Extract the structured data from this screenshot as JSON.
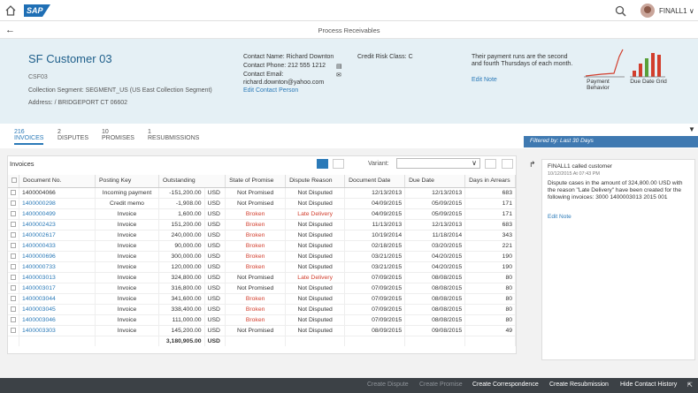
{
  "shell": {
    "logo": "SAP",
    "user": "FINALL1"
  },
  "title": "Process Receivables",
  "customer": {
    "name": "SF Customer 03",
    "id": "CSF03",
    "segment": "Collection Segment: SEGMENT_US (US East Collection Segment)",
    "address": "Address: / BRIDGEPORT CT 06602"
  },
  "contact": {
    "name": "Contact Name: Richard Downton",
    "phone": "Contact Phone: 212 555 1212",
    "email_label": "Contact Email:",
    "email": "richard.downton@yahoo.com",
    "edit": "Edit Contact Person"
  },
  "credit": "Credit Risk Class: C",
  "note": {
    "text": "Their payment runs are the second and fourth Thursdays of each month.",
    "edit": "Edit Note"
  },
  "mini": {
    "payment": "Payment Behavior",
    "duedate": "Due Date Grid"
  },
  "tabs": [
    {
      "count": "216",
      "label": "INVOICES"
    },
    {
      "count": "2",
      "label": "DISPUTES"
    },
    {
      "count": "10",
      "label": "PROMISES"
    },
    {
      "count": "1",
      "label": "RESUBMISSIONS"
    }
  ],
  "filter": "Filtered by: Last 30 Days",
  "invoices": {
    "title": "Invoices",
    "variant_label": "Variant:",
    "columns": [
      "Document No.",
      "Posting Key",
      "Outstanding",
      "State of Promise",
      "Dispute Reason",
      "Document Date",
      "Due Date",
      "Days in Arrears"
    ],
    "rows": [
      [
        "1400004066",
        "Incoming payment",
        "-151,200.00",
        "USD",
        "Not Promised",
        "Not Disputed",
        "12/13/2013",
        "12/13/2013",
        "683"
      ],
      [
        "1400000298",
        "Credit memo",
        "-1,908.00",
        "USD",
        "Not Promised",
        "Not Disputed",
        "04/09/2015",
        "05/09/2015",
        "171"
      ],
      [
        "1400000499",
        "Invoice",
        "1,600.00",
        "USD",
        "Broken",
        "Late Delivery",
        "04/09/2015",
        "05/09/2015",
        "171"
      ],
      [
        "1400002423",
        "Invoice",
        "151,200.00",
        "USD",
        "Broken",
        "Not Disputed",
        "11/13/2013",
        "12/13/2013",
        "683"
      ],
      [
        "1400002617",
        "Invoice",
        "240,000.00",
        "USD",
        "Broken",
        "Not Disputed",
        "10/19/2014",
        "11/18/2014",
        "343"
      ],
      [
        "1400000433",
        "Invoice",
        "90,000.00",
        "USD",
        "Broken",
        "Not Disputed",
        "02/18/2015",
        "03/20/2015",
        "221"
      ],
      [
        "1400000696",
        "Invoice",
        "300,000.00",
        "USD",
        "Broken",
        "Not Disputed",
        "03/21/2015",
        "04/20/2015",
        "190"
      ],
      [
        "1400000733",
        "Invoice",
        "120,000.00",
        "USD",
        "Broken",
        "Not Disputed",
        "03/21/2015",
        "04/20/2015",
        "190"
      ],
      [
        "1400003013",
        "Invoice",
        "324,800.00",
        "USD",
        "Not Promised",
        "Late Delivery",
        "07/09/2015",
        "08/08/2015",
        "80"
      ],
      [
        "1400003017",
        "Invoice",
        "316,800.00",
        "USD",
        "Not Promised",
        "Not Disputed",
        "07/09/2015",
        "08/08/2015",
        "80"
      ],
      [
        "1400003044",
        "Invoice",
        "341,600.00",
        "USD",
        "Broken",
        "Not Disputed",
        "07/09/2015",
        "08/08/2015",
        "80"
      ],
      [
        "1400003045",
        "Invoice",
        "338,400.00",
        "USD",
        "Broken",
        "Not Disputed",
        "07/09/2015",
        "08/08/2015",
        "80"
      ],
      [
        "1400003046",
        "Invoice",
        "111,000.00",
        "USD",
        "Broken",
        "Not Disputed",
        "07/09/2015",
        "08/08/2015",
        "80"
      ],
      [
        "1400003303",
        "Invoice",
        "145,200.00",
        "USD",
        "Not Promised",
        "Not Disputed",
        "08/09/2015",
        "09/08/2015",
        "49"
      ]
    ],
    "total": "3,180,905.00",
    "total_cur": "USD"
  },
  "activity": {
    "title": "FINALL1 called customer",
    "time": "10/12/2015 At 07:43 PM",
    "body": "Dispute cases in the amount of 324,800.00 USD with the reason \"Late Delivery\" have been created for the following invoices: 3000 1400003013 2015 001",
    "edit": "Edit Note"
  },
  "footer": [
    "Create Dispute",
    "Create Promise",
    "Create Correspondence",
    "Create Resubmission",
    "Hide Contact History"
  ],
  "colors": {
    "accent": "#2b7ab8",
    "broken": "#d23e2d",
    "filter": "#3f79b1"
  }
}
